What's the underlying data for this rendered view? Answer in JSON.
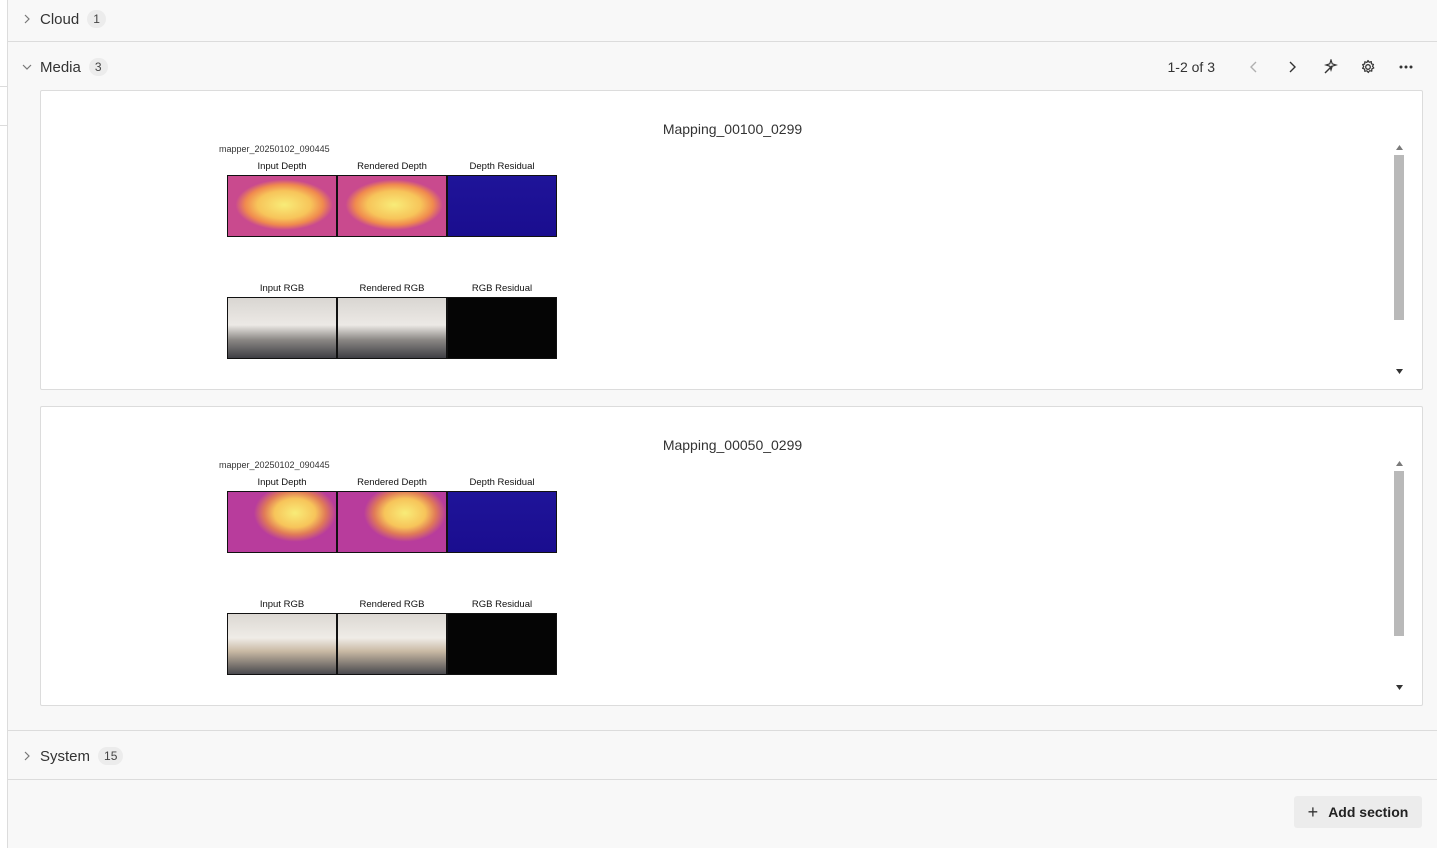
{
  "sections": {
    "cloud": {
      "title": "Cloud",
      "count": "1"
    },
    "media": {
      "title": "Media",
      "count": "3"
    },
    "system": {
      "title": "System",
      "count": "15"
    }
  },
  "toolbar": {
    "pager": "1-2 of 3",
    "icons": [
      "chevron-left-icon",
      "chevron-right-icon",
      "magic-wand-icon",
      "gear-icon",
      "more-horizontal-icon"
    ]
  },
  "panels": [
    {
      "title": "Mapping_00100_0299",
      "figure_title": "mapper_20250102_090445",
      "labels": [
        "Input Depth",
        "Rendered Depth",
        "Depth Residual",
        "Input RGB",
        "Rendered RGB",
        "RGB Residual"
      ],
      "scroll_position": 0.0,
      "scroll_visible_fraction": 0.78
    },
    {
      "title": "Mapping_00050_0299",
      "figure_title": "mapper_20250102_090445",
      "labels": [
        "Input Depth",
        "Rendered Depth",
        "Depth Residual",
        "Input RGB",
        "Rendered RGB",
        "RGB Residual"
      ],
      "scroll_position": 0.0,
      "scroll_visible_fraction": 0.78
    }
  ],
  "add_section": {
    "label": "Add section"
  },
  "colors": {
    "depth_far": "#f6e06a",
    "depth_mid": "#f08a4e",
    "depth_near": "#b83c9c",
    "residual_bg": "#1a0d8f",
    "wall": "#e6e3df",
    "floor": "#4a4a4e",
    "scrollbar_thumb": "#b9b9b9"
  }
}
